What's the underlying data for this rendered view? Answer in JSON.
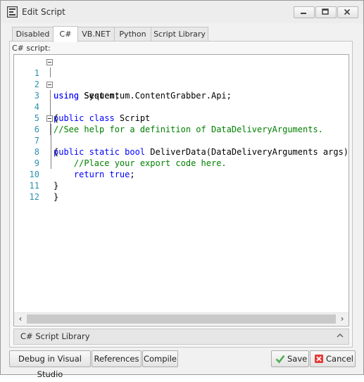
{
  "window": {
    "title": "Edit Script",
    "controls": [
      "minimize",
      "maximize",
      "close"
    ]
  },
  "tabs": [
    {
      "label": "Disabled",
      "active": false
    },
    {
      "label": "C#",
      "active": true
    },
    {
      "label": "VB.NET",
      "active": false
    },
    {
      "label": "Python",
      "active": false
    },
    {
      "label": "Script Library",
      "active": false
    }
  ],
  "editor": {
    "label": "C# script:",
    "lines": [
      {
        "n": "1",
        "text": "using System;"
      },
      {
        "n": "2",
        "text": "using Sequentum.ContentGrabber.Api;"
      },
      {
        "n": "3",
        "text": "public class Script"
      },
      {
        "n": "4",
        "text": "{"
      },
      {
        "n": "5",
        "text": "//See help for a definition of DataDeliveryArguments."
      },
      {
        "n": "6",
        "text": "public static bool DeliverData(DataDeliveryArguments args)"
      },
      {
        "n": "7",
        "text": "{"
      },
      {
        "n": "8",
        "text": "    //Place your export code here."
      },
      {
        "n": "9",
        "text": "    return true;"
      },
      {
        "n": "10",
        "text": "}"
      },
      {
        "n": "11",
        "text": "}"
      },
      {
        "n": "12",
        "text": ""
      }
    ]
  },
  "library_bar": {
    "label": "C# Script Library"
  },
  "footer": {
    "debug_label": "Debug in Visual Studio",
    "references_label": "References",
    "compile_label": "Compile",
    "save_label": "Save",
    "cancel_label": "Cancel"
  },
  "colors": {
    "keyword": "#0000ff",
    "comment": "#008000",
    "line_number": "#2b91af",
    "save_icon": "#4caf50",
    "cancel_icon": "#e53935"
  }
}
